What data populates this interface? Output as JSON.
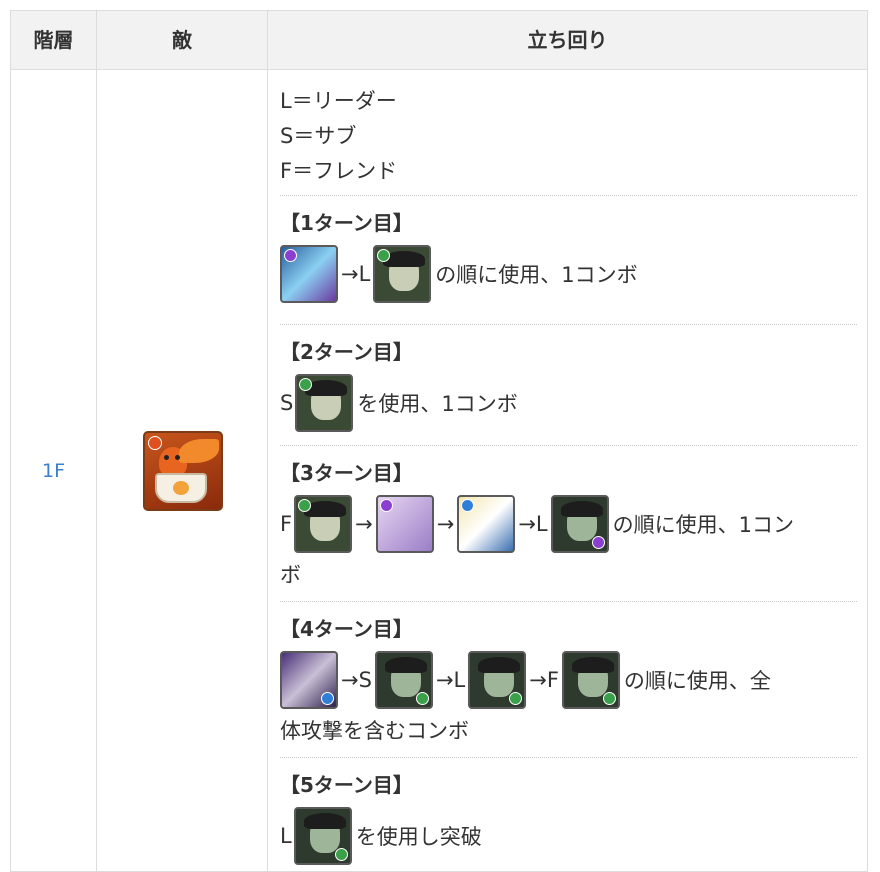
{
  "header": {
    "floor": "階層",
    "enemy": "敵",
    "strategy": "立ち回り"
  },
  "floor": "1F",
  "enemy_icon": "fire-dragon-enemy-icon",
  "legend": [
    "L＝リーダー",
    "S＝サブ",
    "F＝フレンド"
  ],
  "turns": [
    {
      "title": "【1ターン目】",
      "parts": [
        "→L",
        "の順に使用、1コンボ"
      ]
    },
    {
      "title": "【2ターン目】",
      "parts": [
        "S",
        "を使用、1コンボ"
      ]
    },
    {
      "title": "【3ターン目】",
      "parts": [
        "F",
        "→",
        "→",
        "→L",
        "の順に使用、1コン",
        "ボ"
      ]
    },
    {
      "title": "【4ターン目】",
      "parts": [
        "→S",
        "→L",
        "→F",
        "の順に使用、全",
        "体攻撃を含むコンボ"
      ]
    },
    {
      "title": "【5ターン目】",
      "parts": [
        "L",
        "を使用し突破"
      ]
    }
  ],
  "colors": {
    "link": "#3b7fd1",
    "header_bg": "#f2f2f2",
    "border": "#dcdcdc"
  }
}
